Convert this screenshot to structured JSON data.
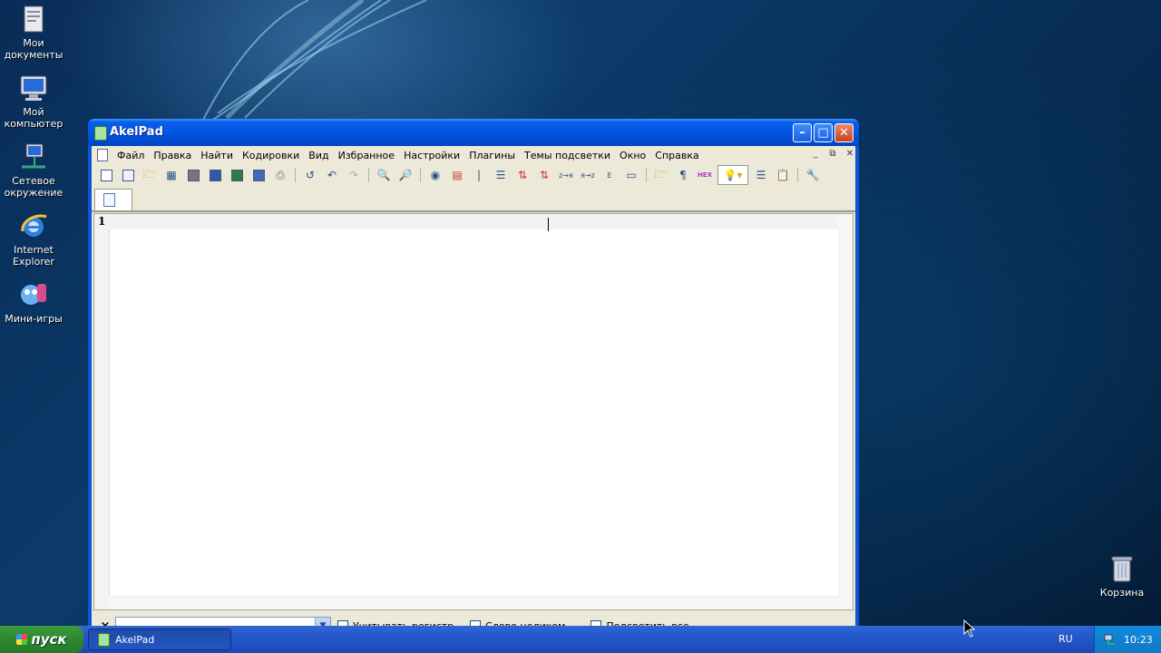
{
  "desktop": {
    "icons": [
      {
        "label": "Мои документы",
        "icon": "folder-documents-icon"
      },
      {
        "label": "Мой компьютер",
        "icon": "my-computer-icon"
      },
      {
        "label": "Сетевое окружение",
        "icon": "network-icon"
      },
      {
        "label": "Internet Explorer",
        "icon": "ie-icon"
      },
      {
        "label": "Мини-игры",
        "icon": "games-icon"
      },
      {
        "label": "Корзина",
        "icon": "recycle-bin-icon"
      }
    ]
  },
  "window": {
    "title": "AkelPad",
    "menu": [
      "Файл",
      "Правка",
      "Найти",
      "Кодировки",
      "Вид",
      "Избранное",
      "Настройки",
      "Плагины",
      "Темы подсветки",
      "Окно",
      "Справка"
    ],
    "editor": {
      "line_number": "1"
    },
    "findbar": {
      "close": "×",
      "search_value": "",
      "match_case": "Учитывать регистр",
      "whole_word": "Слово целиком",
      "highlight_all": "Подсветить все"
    }
  },
  "taskbar": {
    "start_label": "пуск",
    "task_app": "AkelPad",
    "language": "RU",
    "clock": "10:23"
  },
  "colors": {
    "titlebar": "#0055e5",
    "taskbar": "#2457c9",
    "start": "#2f8a2f",
    "close_button": "#c8421b"
  }
}
